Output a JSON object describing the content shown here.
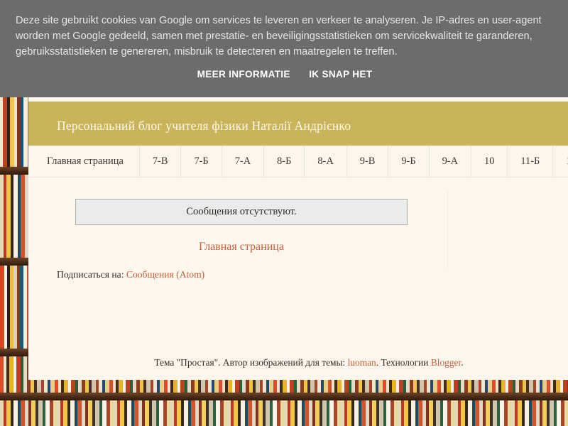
{
  "cookie_banner": {
    "message": "Deze site gebruikt cookies van Google om services te leveren en verkeer te analyseren. Je IP-adres en user-agent worden met Google gedeeld, samen met prestatie- en beveiligingsstatistieken om servicekwaliteit te garanderen, gebruiksstatistieken te genereren, misbruik te detecteren en maatregelen te treffen.",
    "more_info_label": "MEER INFORMATIE",
    "accept_label": "IK SNAP HET",
    "background_color": "#6c6c6c",
    "text_color": "#e6e6e6"
  },
  "header": {
    "title": "Персональний блог учителя фізики Наталії Андрієнко",
    "band_color": "#c9b45c",
    "title_color": "#fcf8ea"
  },
  "tabs": [
    {
      "label": "Главная страница"
    },
    {
      "label": "7-В"
    },
    {
      "label": "7-Б"
    },
    {
      "label": "7-А"
    },
    {
      "label": "8-Б"
    },
    {
      "label": "8-А"
    },
    {
      "label": "9-В"
    },
    {
      "label": "9-Б"
    },
    {
      "label": "9-А"
    },
    {
      "label": "10"
    },
    {
      "label": "11-Б"
    },
    {
      "label": "1"
    }
  ],
  "main": {
    "status_message": "Сообщения отсутствуют.",
    "home_link_label": "Главная страница",
    "subscribe_prefix": "Подписаться на: ",
    "subscribe_link_label": "Сообщения (Atom)"
  },
  "footer": {
    "theme_text": "Тема \"Простая\". Автор изображений для темы: ",
    "image_author_link": "luoman",
    "powered_by_text": ". Технологии ",
    "platform_link": "Blogger",
    "trailing_period": "."
  },
  "theme": {
    "page_background_color": "#fdf6ec",
    "link_color": "#c4603d",
    "body_text_color": "#33302c",
    "status_box_background": "#ebebeb",
    "status_box_border": "#adadad"
  }
}
